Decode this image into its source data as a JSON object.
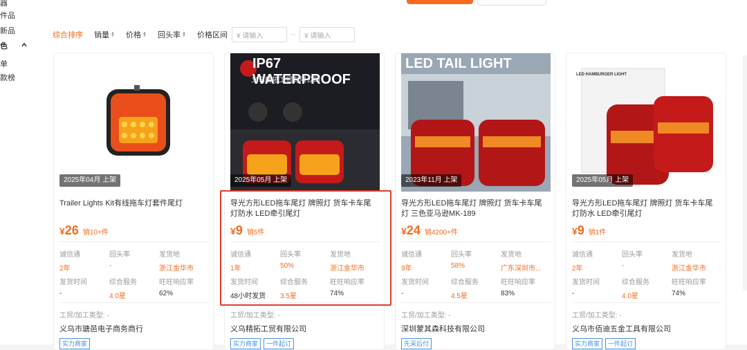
{
  "sidebar": {
    "items": [
      "器",
      "件品",
      "新品",
      "色",
      "单",
      "款榜"
    ]
  },
  "sort": {
    "items": [
      {
        "label": "综合排序",
        "active": true
      },
      {
        "label": "销量"
      },
      {
        "label": "价格"
      },
      {
        "label": "回头率"
      }
    ],
    "price_range_label": "价格区间",
    "min_placeholder": "¥ 请输入",
    "max_placeholder": "¥ 请输入",
    "dash": "–"
  },
  "stat_labels": {
    "chengxin": "诚信通",
    "huitou": "回头率",
    "fahuodi": "发货地",
    "fahuo_time": "发货时间",
    "zonghe": "综合服务",
    "wangwang": "旺旺响应率"
  },
  "biz_type_label": "工贸/加工类型:",
  "products": [
    {
      "image_text": "",
      "listed": "2025年04月 上架",
      "title": "Trailer Lights Kit有线拖车灯套件尾灯",
      "yen": "¥",
      "price": "26",
      "sales": "销10+件",
      "chengxin": "2年",
      "huitou": "-",
      "fahuodi": "浙江金华市",
      "fahuo_time": "-",
      "zonghe": "4.0星",
      "wangwang": "62%",
      "biz_type": "工贸/加工类型: -",
      "company": "义乌市瑭邑电子商务商行",
      "tags": [
        "实力商家"
      ]
    },
    {
      "image_text": "IP67 WATERPROOF",
      "image_sub": "义乌精拓工贸有限公司",
      "listed": "2025年05月 上架",
      "title": "导光方形LED拖车尾灯 牌照灯 货车卡车尾灯防水 LED牵引尾灯",
      "yen": "¥",
      "price": "9",
      "sales": "销5件",
      "chengxin": "1年",
      "huitou": "50%",
      "fahuodi": "浙江金华市",
      "fahuo_time": "48小时发货",
      "zonghe": "3.5星",
      "wangwang": "74%",
      "biz_type": "工贸/加工类型: -",
      "company": "义乌精拓工贸有限公司",
      "tags": [
        "实力商家",
        "一件起订"
      ]
    },
    {
      "image_text": "LED TAIL LIGHT",
      "listed": "2023年11月 上架",
      "title": "导光方形LED拖车尾灯 牌照灯 货车卡车尾灯 三色亚马逊MK-189",
      "yen": "¥",
      "price": "24",
      "sales": "销4200+件",
      "chengxin": "9年",
      "huitou": "58%",
      "fahuodi": "广东深圳市...",
      "fahuo_time": "-",
      "zonghe": "4.5星",
      "wangwang": "83%",
      "biz_type": "工贸/加工类型: -",
      "company": "深圳蒙其森科技有限公司",
      "tags": [
        "先采后付"
      ]
    },
    {
      "image_text": "LED HAMBURGER LIGHT",
      "listed": "2025年05月 上架",
      "title": "导光方形LED拖车尾灯 牌照灯 货车卡车尾灯防水 LED牵引尾灯",
      "yen": "¥",
      "price": "9",
      "sales": "销1件",
      "chengxin": "2年",
      "huitou": "-",
      "fahuodi": "浙江金华市",
      "fahuo_time": "-",
      "zonghe": "4.0星",
      "wangwang": "74%",
      "biz_type": "工贸/加工类型: -",
      "company": "义乌市佰迪五金工具有限公司",
      "tags": [
        "实力商家",
        "一件起订"
      ]
    }
  ],
  "colors": {
    "accent": "#f56a1e",
    "highlight": "#e03b2e",
    "tag_blue": "#4a90e2"
  }
}
